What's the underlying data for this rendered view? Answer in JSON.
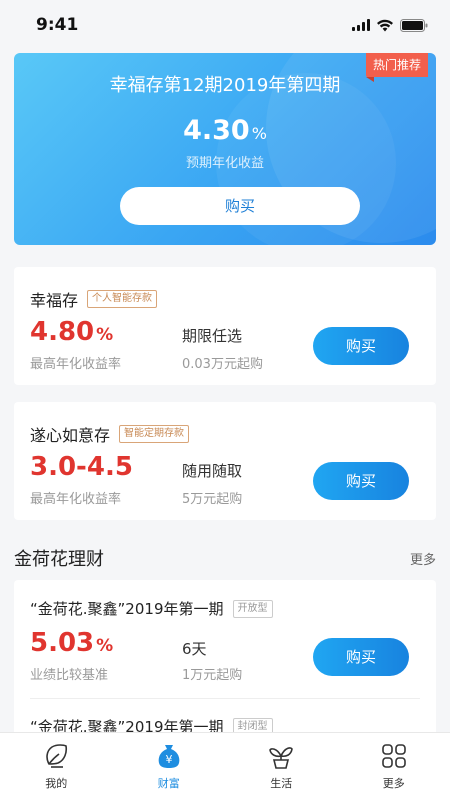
{
  "status_bar": {
    "time": "9:41"
  },
  "featured": {
    "ribbon": "热门推荐",
    "title": "幸福存第12期2019年第四期",
    "rate": "4.30",
    "rate_unit": "%",
    "rate_label": "预期年化收益",
    "buy_label": "购买"
  },
  "products": [
    {
      "name": "幸福存",
      "tag": "个人智能存款",
      "rate": "4.80",
      "rate_unit": "%",
      "rate_label": "最高年化收益率",
      "term": "期限任选",
      "min_amount": "0.03万元起购",
      "buy_label": "购买"
    },
    {
      "name": "遂心如意存",
      "tag": "智能定期存款",
      "rate": "3.0-4.5",
      "rate_unit": "",
      "rate_label": "最高年化收益率",
      "term": "随用随取",
      "min_amount": "5万元起购",
      "buy_label": "购买"
    }
  ],
  "section": {
    "title": "金荷花理财",
    "more": "更多"
  },
  "wealth_items": [
    {
      "name": "“金荷花.聚鑫”2019年第一期",
      "tag": "开放型",
      "rate": "5.03",
      "rate_unit": "%",
      "rate_label": "业绩比较基准",
      "term": "6天",
      "min_amount": "1万元起购",
      "buy_label": "购买"
    },
    {
      "name": "“金荷花.聚鑫”2019年第一期",
      "tag": "封闭型"
    }
  ],
  "tabbar": {
    "tabs": [
      {
        "label": "我的",
        "icon": "leaf-icon",
        "active": false
      },
      {
        "label": "财富",
        "icon": "money-bag-icon",
        "active": true
      },
      {
        "label": "生活",
        "icon": "plant-icon",
        "active": false
      },
      {
        "label": "更多",
        "icon": "grid-icon",
        "active": false
      }
    ]
  },
  "colors": {
    "accent": "#1e8de0",
    "rate_red": "#e0352f",
    "ribbon": "#f25f4c"
  }
}
